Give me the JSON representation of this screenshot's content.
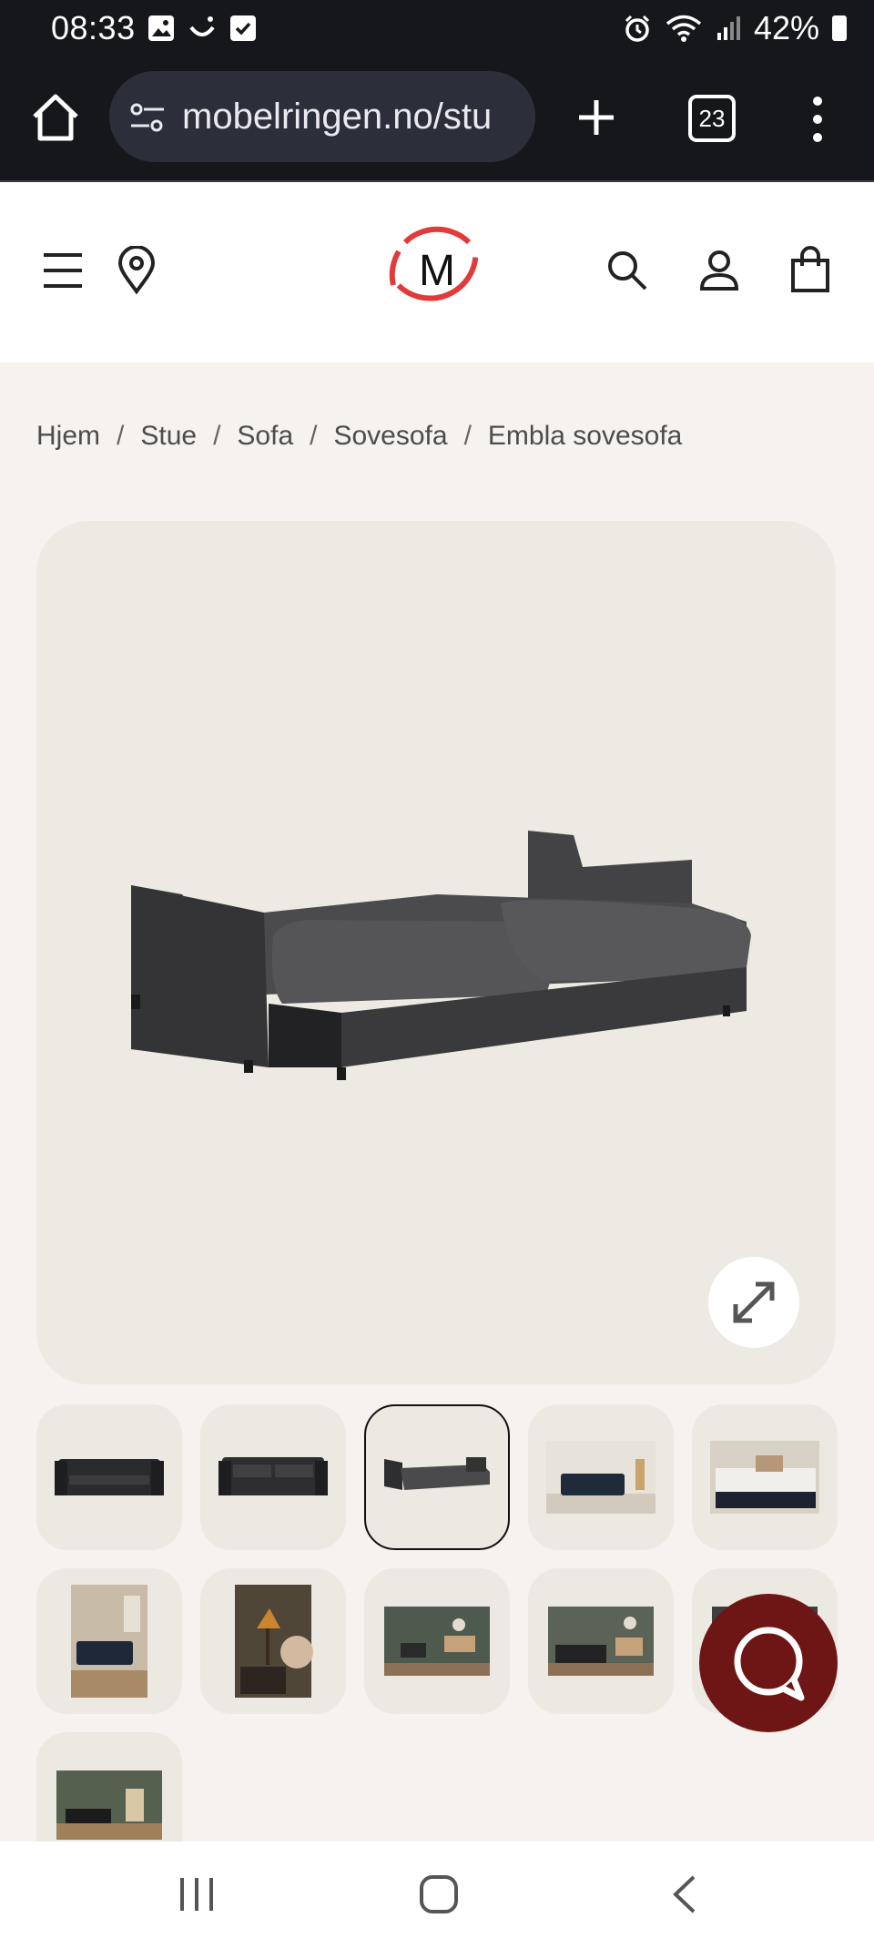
{
  "status": {
    "time": "08:33",
    "battery": "42%",
    "icons": [
      "image-icon",
      "smile-icon",
      "checkbox-icon",
      "alarm-icon",
      "wifi-icon",
      "signal-icon",
      "battery-icon"
    ]
  },
  "browser": {
    "url": "mobelringen.no/stu",
    "tab_count": "23"
  },
  "header": {
    "logo_letter": "M",
    "brand_color": "#e23a3a"
  },
  "breadcrumb": [
    "Hjem",
    "Stue",
    "Sofa",
    "Sovesofa",
    "Embla sovesofa"
  ],
  "gallery": {
    "selected_index": 2,
    "thumbnails": [
      "sofa-front",
      "sofa-front-2",
      "sofa-bed-open",
      "living-room-scene",
      "bed-made-scene",
      "lounge-scene",
      "lamp-detail-scene",
      "workspace-scene",
      "bedroom-scene",
      "partial-scene",
      "dark-room-scene"
    ]
  },
  "colors": {
    "chat_button": "#6e1616",
    "page_bg": "#f5f2ef",
    "card_bg": "#ede9e3"
  }
}
